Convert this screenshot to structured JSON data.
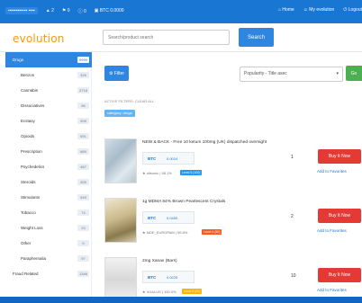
{
  "topbar": {
    "user_chip": "▪▪▪▪▪▪▪▪▪▪▪▪ ▪▪▪▪",
    "stat1": "2",
    "stat2": "0",
    "stat3": "0",
    "btc_rate": "BTC 0.0000",
    "home": "Home",
    "my_evolution": "My evolution",
    "logout": "Logout"
  },
  "header": {
    "logo_text": "evolution",
    "search_placeholder": "Search/product search",
    "search_button": "Search"
  },
  "sidebar": {
    "items": [
      {
        "label": "Drugs",
        "count": "9999",
        "active": true
      },
      {
        "label": "Benzos",
        "count": "326"
      },
      {
        "label": "Cannabis",
        "count": "2718"
      },
      {
        "label": "Dissociatives",
        "count": "96"
      },
      {
        "label": "Ecstasy",
        "count": "999"
      },
      {
        "label": "Opioids",
        "count": "591"
      },
      {
        "label": "Prescription",
        "count": "689"
      },
      {
        "label": "Psychedelics",
        "count": "467"
      },
      {
        "label": "Steroids",
        "count": "309"
      },
      {
        "label": "Stimulants",
        "count": "949"
      },
      {
        "label": "Tobacco",
        "count": "74"
      },
      {
        "label": "Weight Loss",
        "count": "23"
      },
      {
        "label": "Other",
        "count": "9"
      },
      {
        "label": "Paraphernalia",
        "count": "97"
      },
      {
        "label": "Fraud Related",
        "count": "1346"
      }
    ]
  },
  "main": {
    "filter_button": "Filter",
    "sort_value": "Popularity - Title asec",
    "go_button": "Go",
    "filter_label": "ACTIVE FILTERS: CLEAR ALL",
    "filter_tag": "category: drugs",
    "buy_label": "Buy It Now",
    "fav_label": "Add to Favorites",
    "listings": [
      {
        "title": "NEW & BACK - Free 10 ketum 100mg (UK) dispatched overnight",
        "currency": "BTC",
        "price": "0.0024",
        "vendor": "★ ultsonic | 98.1%",
        "badge": "Level 5 (100)",
        "badge_color": "#2196f3",
        "qty": "1"
      },
      {
        "title": "1g MDMA 84% Brown Pearlescent Crystals",
        "currency": "BTC",
        "price": "0.0459",
        "vendor": "★ MDE_EUROPAM | 96.8%",
        "badge": "Level 4 (50)",
        "badge_color": "#ff5722",
        "qty": "2"
      },
      {
        "title": "2mg Xanax (Bars)",
        "currency": "BTC",
        "price": "0.0225",
        "vendor": "★ XUALUS | 100.0%",
        "badge": "Level 3 (20)",
        "badge_color": "#ffb300",
        "qty": "10"
      }
    ]
  },
  "colors": {
    "topbar": "#1976d2",
    "accent": "#2f86e0",
    "buy": "#e53935",
    "go": "#4caf50",
    "logo": "#ff9800"
  }
}
